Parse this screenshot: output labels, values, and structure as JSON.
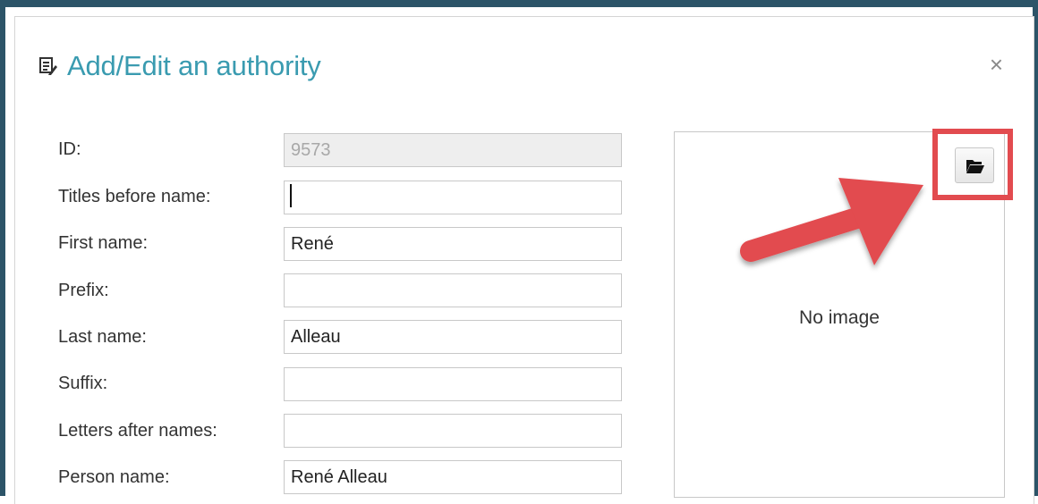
{
  "dialog": {
    "title": "Add/Edit an authority",
    "close_symbol": "×",
    "title_icon": "edit-note-icon",
    "accent_color": "#3a9bb0",
    "frame_color": "#2c5468",
    "highlight_color": "#e24b4f"
  },
  "form": {
    "fields": [
      {
        "label": "ID:",
        "value": "9573",
        "readonly": true
      },
      {
        "label": "Titles before name:",
        "value": "",
        "focused": true
      },
      {
        "label": "First name:",
        "value": "René"
      },
      {
        "label": "Prefix:",
        "value": ""
      },
      {
        "label": "Last name:",
        "value": "Alleau"
      },
      {
        "label": "Suffix:",
        "value": ""
      },
      {
        "label": "Letters after names:",
        "value": ""
      },
      {
        "label": "Person name:",
        "value": "René Alleau"
      }
    ]
  },
  "image_panel": {
    "placeholder_text": "No image",
    "browse_icon": "folder-open-icon"
  }
}
